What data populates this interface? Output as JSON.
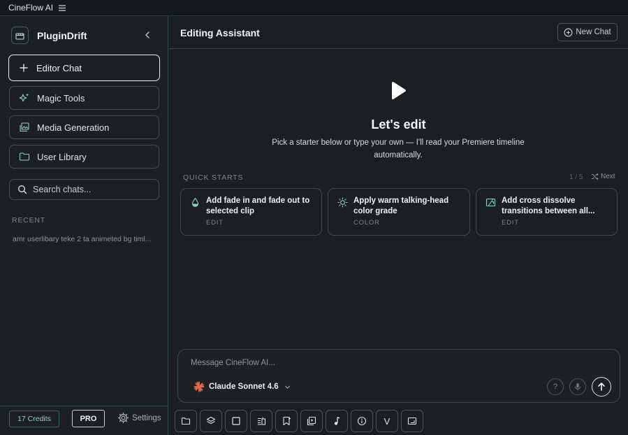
{
  "window": {
    "title": "CineFlow AI"
  },
  "sidebar": {
    "brand": "PluginDrift",
    "nav": [
      {
        "label": "Editor Chat",
        "icon": "plus-icon",
        "active": true
      },
      {
        "label": "Magic Tools",
        "icon": "sparkles-icon",
        "active": false
      },
      {
        "label": "Media Generation",
        "icon": "images-icon",
        "active": false
      },
      {
        "label": "User Library",
        "icon": "folder-icon",
        "active": false
      }
    ],
    "search_placeholder": "Search chats...",
    "recent_label": "RECENT",
    "recent_items": [
      "amr userlibary teke 2 ta animeted bg timl..."
    ],
    "footer": {
      "credits": "17 Credits",
      "plan": "PRO",
      "settings": "Settings"
    }
  },
  "main": {
    "title": "Editing Assistant",
    "new_chat": "New Chat",
    "hero": {
      "title": "Let's edit",
      "subtitle": "Pick a starter below or type your own — I'll read your Premiere timeline automatically."
    },
    "quick_starts": {
      "label": "QUICK STARTS",
      "pager": "1 / 5",
      "next": "Next",
      "cards": [
        {
          "title": "Add fade in and fade out to selected clip",
          "tag": "EDIT",
          "icon": "droplet-icon"
        },
        {
          "title": "Apply warm talking-head color grade",
          "tag": "COLOR",
          "icon": "sun-icon"
        },
        {
          "title": "Add cross dissolve transitions between all...",
          "tag": "EDIT",
          "icon": "transition-icon"
        }
      ]
    },
    "composer": {
      "placeholder": "Message CineFlow AI...",
      "model": "Claude Sonnet 4.6",
      "help": "?"
    },
    "toolbar": {
      "items": [
        "folder-icon",
        "layers-icon",
        "square-icon",
        "clip-icon",
        "marker-icon",
        "media-icon",
        "music-icon",
        "info-icon",
        "v-icon",
        "frame-icon"
      ],
      "v_label": "V"
    }
  },
  "colors": {
    "accent": "#8fd0c6",
    "background": "#1b1f22",
    "border": "#2f4a47",
    "model_spark": "#e2674a"
  }
}
